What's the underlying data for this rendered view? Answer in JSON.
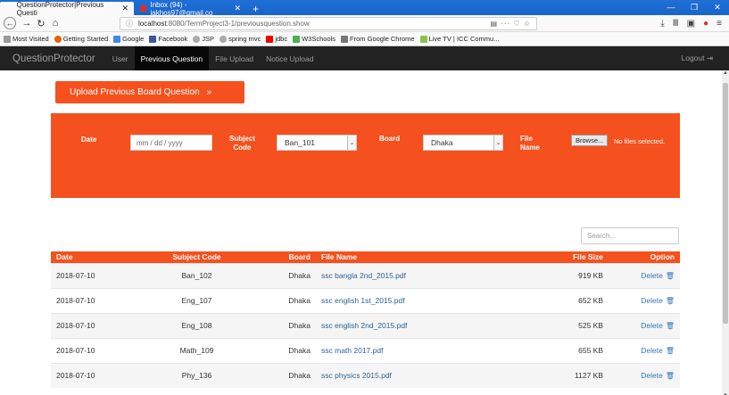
{
  "browser": {
    "tabs": [
      {
        "title": "QuestionProtector|Previous Questi",
        "close": "✕"
      },
      {
        "title": "Inbox (94) - jakhos97@gmail.co",
        "close": "✕"
      }
    ],
    "new_tab": "+",
    "url_host": "localhost",
    "url_path": ":8080/TermProject3-1/previousquestion.show",
    "url_actions": "▤ ··· ♡ ☆",
    "bookmarks": [
      "Most Visited",
      "Getting Started",
      "Google",
      "Facebook",
      "JSP",
      "spring mvc",
      "jdbc",
      "W3Schools",
      "From Google Chrome",
      "Live TV | ICC Commu..."
    ],
    "colors": {
      "tabbar": "#1a65c9",
      "chrome_bg": "#f9f9fa"
    }
  },
  "app": {
    "brand": "QuestionProtector",
    "nav": [
      "User",
      "Previous Question",
      "File Upload",
      "Notice Upload"
    ],
    "active_nav": "Previous Question",
    "logout": "Logout",
    "accent": "#f4511e"
  },
  "upload_button": {
    "label": "Upload Previous Board Question",
    "arrow": "»"
  },
  "filters": {
    "date_label": "Date",
    "date_placeholder": "mm / dd / yyyy",
    "subject_label_1": "Subject",
    "subject_label_2": "Code",
    "subject_value": "Ban_101",
    "board_label": "Board",
    "board_value": "Dhaka",
    "file_label_1": "File",
    "file_label_2": "Name",
    "browse_label": "Browse...",
    "no_file_text": "No files selected."
  },
  "search": {
    "placeholder": "Search..."
  },
  "table": {
    "headers": [
      "Date",
      "Subject Code",
      "Board",
      "File Name",
      "File Size",
      "Option"
    ],
    "rows": [
      {
        "date": "2018-07-10",
        "code": "Ban_102",
        "board": "Dhaka",
        "file": "ssc bangla 2nd_2015.pdf",
        "size": "919 KB",
        "option": "Delete"
      },
      {
        "date": "2018-07-10",
        "code": "Eng_107",
        "board": "Dhaka",
        "file": "ssc english 1st_2015.pdf",
        "size": "652 KB",
        "option": "Delete"
      },
      {
        "date": "2018-07-10",
        "code": "Eng_108",
        "board": "Dhaka",
        "file": "ssc english 2nd_2015.pdf",
        "size": "525 KB",
        "option": "Delete"
      },
      {
        "date": "2018-07-10",
        "code": "Math_109",
        "board": "Dhaka",
        "file": "ssc math 2017.pdf",
        "size": "655 KB",
        "option": "Delete"
      },
      {
        "date": "2018-07-10",
        "code": "Phy_136",
        "board": "Dhaka",
        "file": "ssc physics 2015.pdf",
        "size": "1127 KB",
        "option": "Delete"
      }
    ]
  }
}
